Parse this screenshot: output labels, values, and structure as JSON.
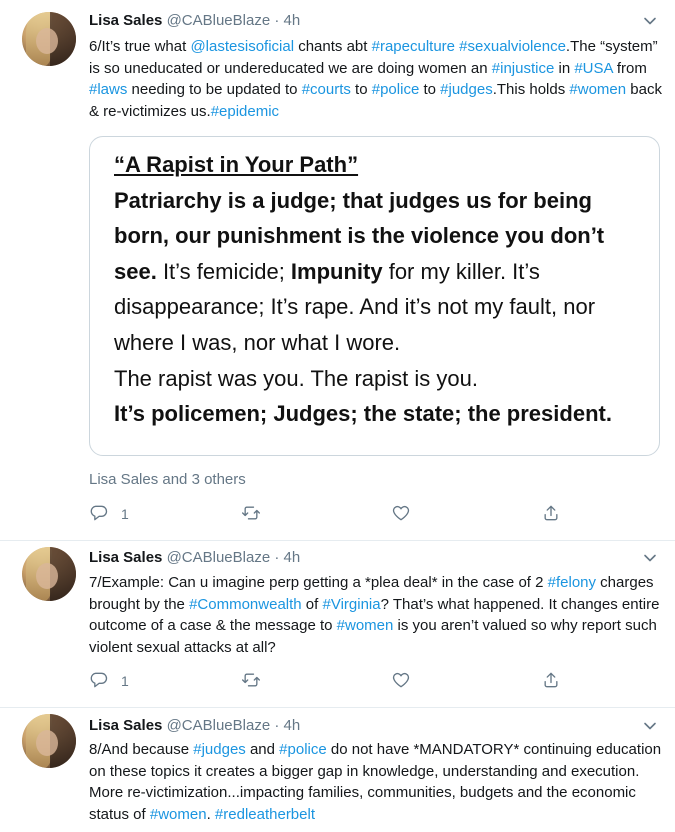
{
  "tweets": [
    {
      "author": "Lisa Sales",
      "handle": "@CABlueBlaze",
      "dot": "·",
      "time": "4h",
      "social_context": "Lisa Sales and 3 others",
      "reply_count": "1",
      "card": {
        "title": "“A Rapist in Your Path”",
        "bold1": "Patriarchy is a judge; that judges us for being born, our punishment is the violence you don’t see.",
        "plain1": " It’s femicide; ",
        "bold2": "Impunity",
        "plain2": " for my killer. It’s disappearance; It’s rape. And it’s not my fault, nor where I was, nor what I wore.",
        "plain3": "The rapist was you. The rapist is you.",
        "bold3": "It’s policemen; Judges; the state; the president."
      }
    },
    {
      "author": "Lisa Sales",
      "handle": "@CABlueBlaze",
      "dot": "·",
      "time": "4h",
      "reply_count": "1"
    },
    {
      "author": "Lisa Sales",
      "handle": "@CABlueBlaze",
      "dot": "·",
      "time": "4h"
    }
  ],
  "t1_text": [
    {
      "t": "6/It’s true what ",
      "tag": false
    },
    {
      "t": "@lastesisoficial",
      "tag": true
    },
    {
      "t": " chants abt ",
      "tag": false
    },
    {
      "t": "#rapeculture",
      "tag": true
    },
    {
      "t": " ",
      "tag": false
    },
    {
      "t": "#sexualviolence",
      "tag": true
    },
    {
      "t": ".The “system” is so uneducated or undereducated we are doing women an ",
      "tag": false
    },
    {
      "t": "#injustice",
      "tag": true
    },
    {
      "t": " in ",
      "tag": false
    },
    {
      "t": "#USA",
      "tag": true
    },
    {
      "t": " from ",
      "tag": false
    },
    {
      "t": "#laws",
      "tag": true
    },
    {
      "t": " needing to be updated to ",
      "tag": false
    },
    {
      "t": "#courts",
      "tag": true
    },
    {
      "t": " to ",
      "tag": false
    },
    {
      "t": "#police",
      "tag": true
    },
    {
      "t": " to ",
      "tag": false
    },
    {
      "t": "#judges",
      "tag": true
    },
    {
      "t": ".This holds ",
      "tag": false
    },
    {
      "t": "#women",
      "tag": true
    },
    {
      "t": " back & re-victimizes us.",
      "tag": false
    },
    {
      "t": "#epidemic",
      "tag": true
    }
  ],
  "t2_text": [
    {
      "t": "7/Example: Can u imagine perp getting a *plea deal* in the case of 2 ",
      "tag": false
    },
    {
      "t": "#felony",
      "tag": true
    },
    {
      "t": " charges brought by the ",
      "tag": false
    },
    {
      "t": "#Commonwealth",
      "tag": true
    },
    {
      "t": " of ",
      "tag": false
    },
    {
      "t": "#Virginia",
      "tag": true
    },
    {
      "t": "? That’s what happened. It changes entire outcome of a case & the message to ",
      "tag": false
    },
    {
      "t": "#women",
      "tag": true
    },
    {
      "t": " is you aren’t valued so why report such violent sexual attacks at all?",
      "tag": false
    }
  ],
  "t3_text": [
    {
      "t": "8/And because ",
      "tag": false
    },
    {
      "t": "#judges",
      "tag": true
    },
    {
      "t": " and ",
      "tag": false
    },
    {
      "t": "#police",
      "tag": true
    },
    {
      "t": " do not have *MANDATORY* continuing education on these topics it creates a bigger gap in knowledge, understanding and execution. More re-victimization...impacting families, communities, budgets and the economic status of ",
      "tag": false
    },
    {
      "t": "#women",
      "tag": true
    },
    {
      "t": ". ",
      "tag": false
    },
    {
      "t": "#redleatherbelt",
      "tag": true
    }
  ],
  "colors": {
    "link": "#1b95e0",
    "muted": "#657786",
    "text": "#14171a",
    "border": "#ccd6dd"
  },
  "icons": [
    "chevron-down-icon",
    "reply-icon",
    "retweet-icon",
    "like-icon",
    "share-icon"
  ]
}
